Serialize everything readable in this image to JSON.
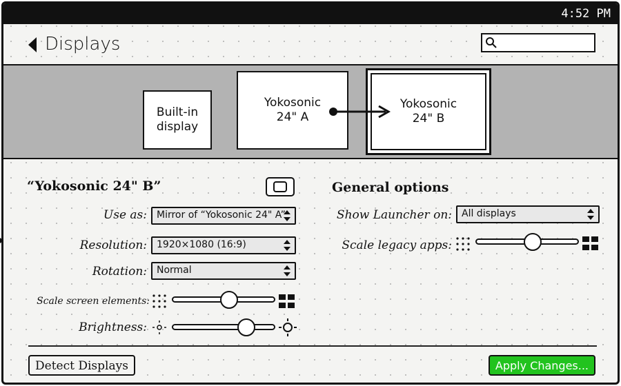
{
  "status_bar": {
    "time": "4:52 PM"
  },
  "header": {
    "title": "Displays",
    "search": {
      "placeholder": ""
    }
  },
  "displays": [
    {
      "label": "Built-in\ndisplay",
      "selected": false
    },
    {
      "label": "Yokosonic\n24\" A",
      "selected": false
    },
    {
      "label": "Yokosonic\n24\" B",
      "selected": true
    }
  ],
  "mirror_arrow": "Yokosonic 24\" A → Yokosonic 24\" B",
  "display_settings": {
    "title": "“Yokosonic 24\" B”",
    "use_as": {
      "label": "Use as:",
      "value": "Mirror of “Yokosonic 24\" A”"
    },
    "resolution": {
      "label": "Resolution:",
      "value": "1920×1080 (16:9)"
    },
    "rotation": {
      "label": "Rotation:",
      "value": "Normal"
    },
    "scale": {
      "label": "Scale screen elements:",
      "level": 0.55
    },
    "brightness": {
      "label": "Brightness:",
      "level": 0.72
    }
  },
  "general_options": {
    "title": "General options",
    "show_launcher": {
      "label": "Show Launcher on:",
      "value": "All displays"
    },
    "scale_legacy": {
      "label": "Scale legacy apps:",
      "level": 0.55
    }
  },
  "buttons": {
    "detect": "Detect Displays",
    "apply": "Apply Changes..."
  },
  "colors": {
    "accent": "#22c31e",
    "band": "#b3b3b3",
    "topbar": "#111111"
  },
  "icons": [
    "back-icon",
    "search-icon",
    "chevrons-icon",
    "small-dots-icon",
    "large-blocks-icon",
    "sun-small-icon",
    "sun-large-icon"
  ]
}
